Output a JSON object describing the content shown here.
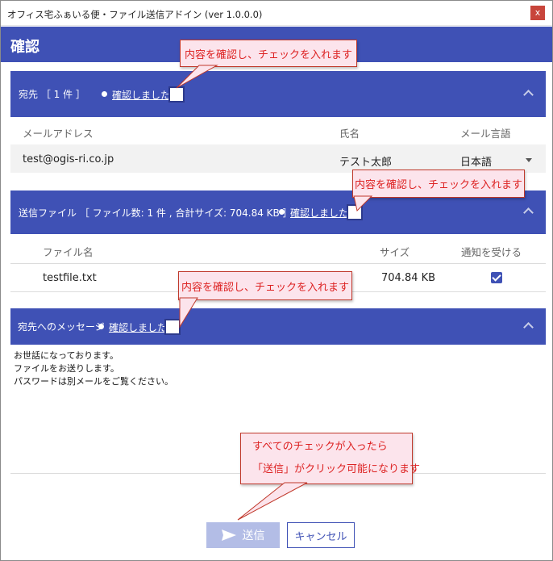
{
  "window": {
    "title": "オフィス宅ふぁいる便・ファイル送信アドイン (ver 1.0.0.0)",
    "close_label": "x"
  },
  "header": {
    "title": "確認"
  },
  "recipients": {
    "section_label": "宛先 ［ 1 件 ］",
    "confirm_label": "確認しました",
    "columns": [
      "メールアドレス",
      "氏名",
      "メール言語"
    ],
    "rows": [
      {
        "email": "test@ogis-ri.co.jp",
        "name": "テスト太郎",
        "language": "日本語"
      }
    ]
  },
  "files": {
    "section_label": "送信ファイル ［ ファイル数: 1 件 , 合計サイズ: 704.84 KB ］",
    "confirm_label": "確認しました",
    "columns": [
      "ファイル名",
      "サイズ",
      "通知を受ける"
    ],
    "rows": [
      {
        "filename": "testfile.txt",
        "size": "704.84 KB",
        "notify": true
      }
    ]
  },
  "message": {
    "section_label": "宛先へのメッセージ",
    "confirm_label": "確認しました",
    "lines": [
      "お世話になっております。",
      "ファイルをお送りします。",
      "パスワードは別メールをご覧ください。"
    ]
  },
  "buttons": {
    "send": "送信",
    "cancel": "キャンセル"
  },
  "callouts": {
    "check_hint": "内容を確認し、チェックを入れます",
    "final_line1": "すべてのチェックが入ったら",
    "final_line2": "「送信」がクリック可能になります"
  },
  "colors": {
    "primary": "#3f51b5",
    "callout_border": "#c0392b",
    "callout_bg": "#fce4ec",
    "callout_text": "#dd2222"
  }
}
